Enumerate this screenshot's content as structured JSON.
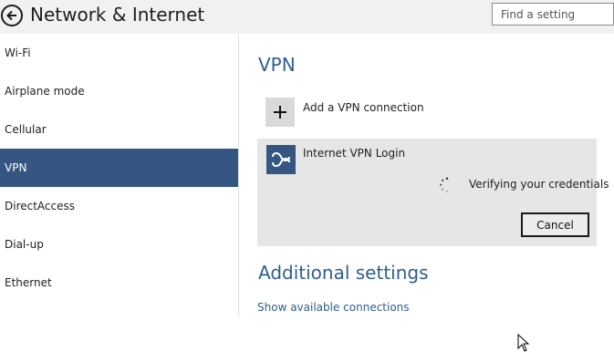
{
  "header": {
    "title": "Network & Internet",
    "back_icon": "back-arrow-icon",
    "search_placeholder": "Find a setting"
  },
  "sidebar": {
    "items": [
      {
        "label": "Wi-Fi"
      },
      {
        "label": "Airplane mode"
      },
      {
        "label": "Cellular"
      },
      {
        "label": "VPN",
        "selected": true
      },
      {
        "label": "DirectAccess"
      },
      {
        "label": "Dial-up"
      },
      {
        "label": "Ethernet"
      }
    ]
  },
  "main": {
    "vpn_heading": "VPN",
    "add_connection": {
      "icon": "plus-icon",
      "label": "Add a VPN connection"
    },
    "connection": {
      "icon": "vpn-link-icon",
      "name": "Internet VPN Login",
      "status": "Verifying your credentials",
      "cancel_label": "Cancel"
    },
    "additional_heading": "Additional settings",
    "available_link": "Show available connections"
  },
  "colors": {
    "accent": "#355681",
    "heading": "#2e5f8f",
    "header_bg": "#f1f1f1",
    "panel_bg": "#e6e6e6"
  }
}
